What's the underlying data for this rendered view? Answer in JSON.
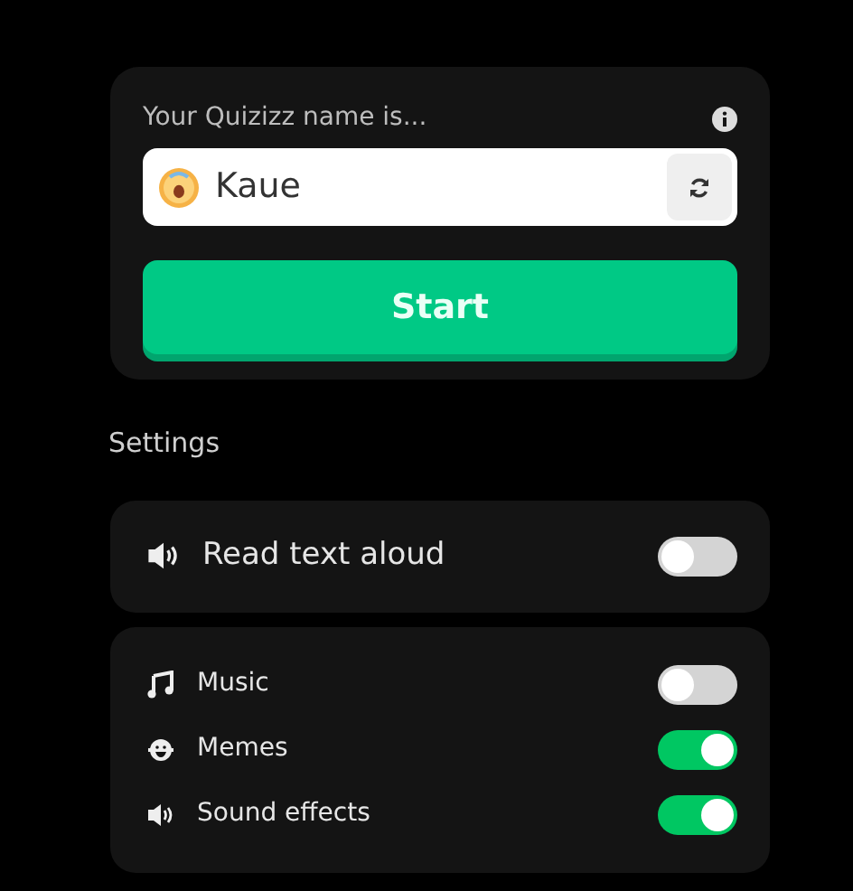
{
  "name_card": {
    "label": "Your Quizizz name is...",
    "name_value": "Kaue",
    "start_button": "Start"
  },
  "settings_heading": "Settings",
  "settings_groups": [
    [
      {
        "kind": "speaker",
        "label": "Read text aloud",
        "on": false
      }
    ],
    [
      {
        "kind": "music",
        "label": "Music",
        "on": false
      },
      {
        "kind": "emoji",
        "label": "Memes",
        "on": true
      },
      {
        "kind": "speaker",
        "label": "Sound effects",
        "on": true
      }
    ]
  ]
}
